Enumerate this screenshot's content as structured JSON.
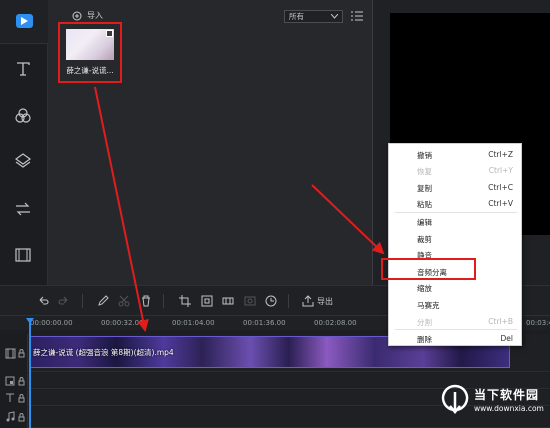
{
  "media_panel": {
    "import_label": "导入",
    "filter_value": "所有",
    "clip_thumbnail_label": "薛之谦-说谎..."
  },
  "timeline": {
    "ruler_ticks": [
      "00:00:00.00",
      "00:00:32.00",
      "00:01:04.00",
      "00:01:36.00",
      "00:02:08.00",
      "00:03:4"
    ],
    "clip_label": "薛之谦-说谎 (超强音浪 第8期)(超清).mp4",
    "export_label": "导出"
  },
  "context_menu": {
    "items": [
      {
        "label": "撤销",
        "shortcut": "Ctrl+Z",
        "enabled": true
      },
      {
        "label": "恢复",
        "shortcut": "Ctrl+Y",
        "enabled": false
      },
      {
        "label": "复制",
        "shortcut": "Ctrl+C",
        "enabled": true
      },
      {
        "label": "粘贴",
        "shortcut": "Ctrl+V",
        "enabled": true
      },
      {
        "label": "编辑",
        "shortcut": "",
        "enabled": true
      },
      {
        "label": "裁剪",
        "shortcut": "",
        "enabled": true
      },
      {
        "label": "静音",
        "shortcut": "",
        "enabled": true
      },
      {
        "label": "音频分离",
        "shortcut": "",
        "enabled": true
      },
      {
        "label": "缩放",
        "shortcut": "",
        "enabled": true
      },
      {
        "label": "马赛克",
        "shortcut": "",
        "enabled": true
      },
      {
        "label": "分割",
        "shortcut": "Ctrl+B",
        "enabled": false
      },
      {
        "label": "删除",
        "shortcut": "Del",
        "enabled": true
      }
    ]
  },
  "watermark": {
    "title": "当下软件园",
    "url": "www.downxia.com"
  },
  "colors": {
    "accent": "#2f8ff0",
    "annotation_red": "#e01d1d"
  }
}
